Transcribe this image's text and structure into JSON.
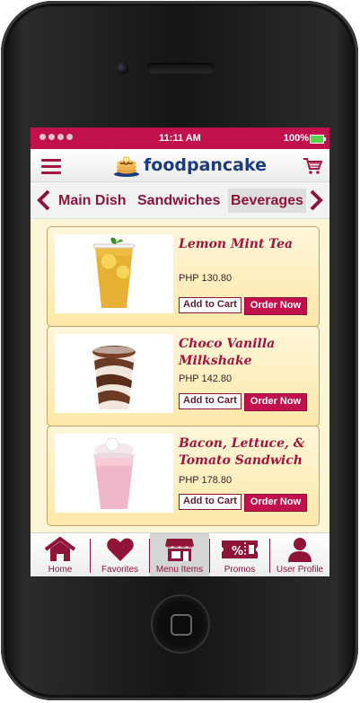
{
  "status_bar": {
    "time": "11:11 AM",
    "battery": "100%"
  },
  "header": {
    "brand": "foodpancake",
    "menu_icon": "hamburger-icon",
    "cart_icon": "cart-icon"
  },
  "category_tabs": {
    "items": [
      {
        "label": "Main Dish"
      },
      {
        "label": "Sandwiches"
      },
      {
        "label": "Beverages",
        "selected": true
      }
    ]
  },
  "products": [
    {
      "name": "Lemon Mint Tea",
      "price": "PHP 130.80",
      "add_label": "Add to Cart",
      "order_label": "Order Now"
    },
    {
      "name": "Choco Vanilla Milkshake",
      "price": "PHP 142.80",
      "add_label": "Add to Cart",
      "order_label": "Order Now"
    },
    {
      "name": "Bacon, Lettuce, & Tomato Sandwich",
      "price": "PHP 178.80",
      "add_label": "Add to Cart",
      "order_label": "Order Now"
    }
  ],
  "bottom_nav": {
    "items": [
      {
        "label": "Home",
        "icon": "home-icon"
      },
      {
        "label": "Favorites",
        "icon": "heart-icon"
      },
      {
        "label": "Menu Items",
        "icon": "store-icon",
        "active": true
      },
      {
        "label": "Promos",
        "icon": "coupon-icon"
      },
      {
        "label": "User Profile",
        "icon": "user-icon"
      }
    ]
  },
  "colors": {
    "accent": "#c2104c",
    "brand_text": "#1c3c7c",
    "card_bg": "#fde8a9"
  }
}
